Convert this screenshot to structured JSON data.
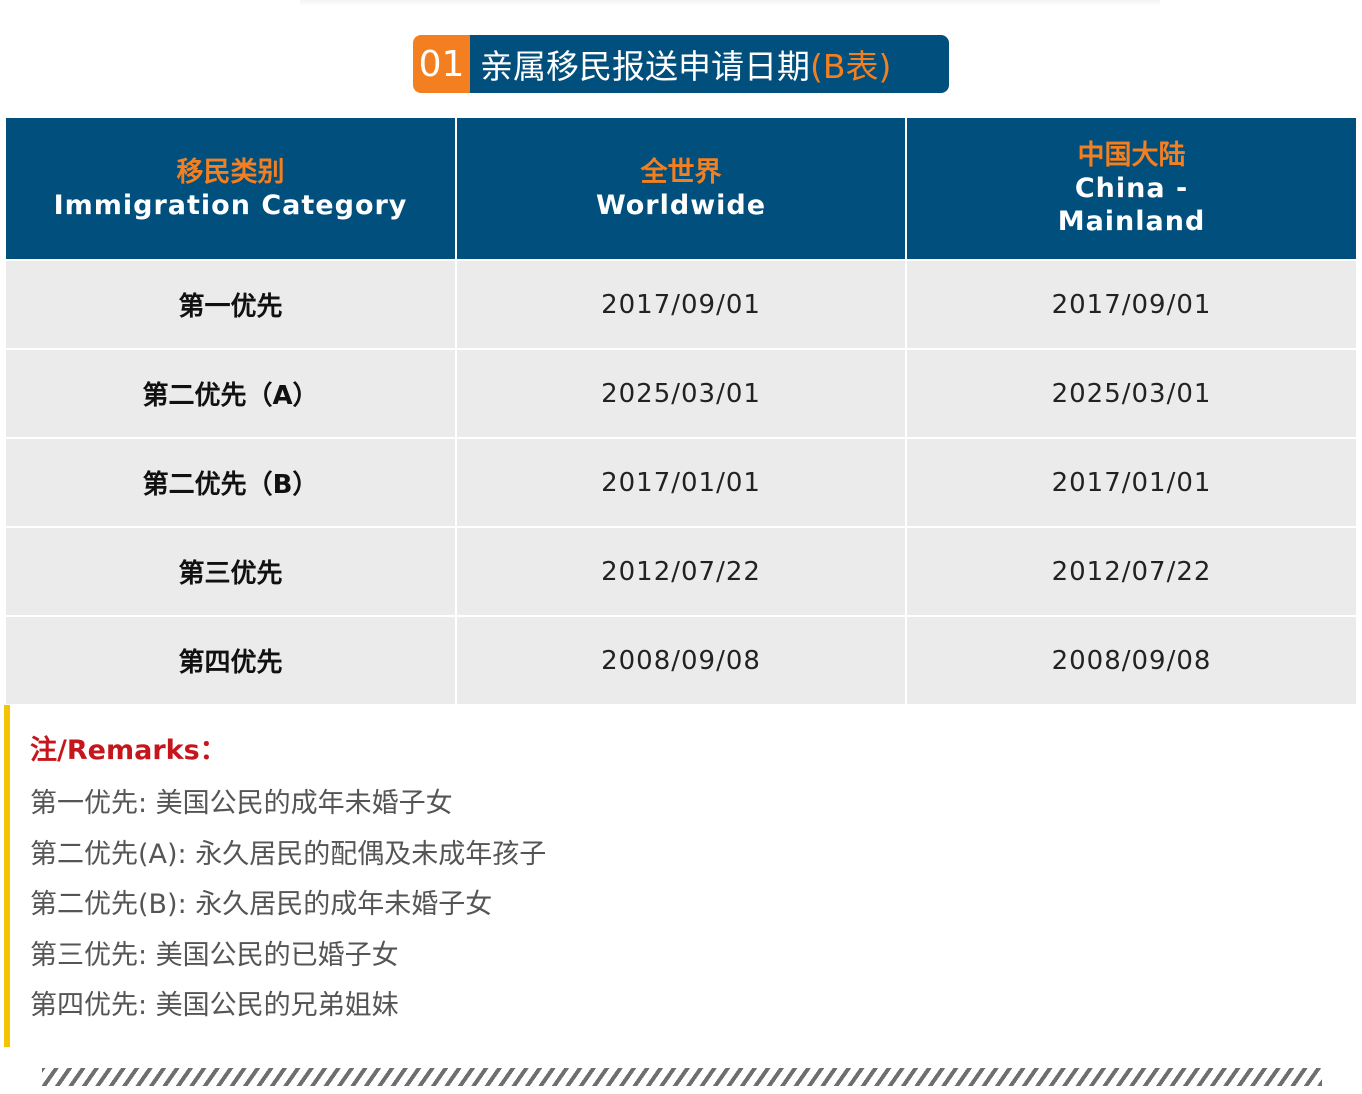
{
  "section": {
    "number": "01",
    "title": "亲属移民报送申请日期",
    "title_suffix": "(B表)"
  },
  "table": {
    "headers": [
      {
        "cn": "移民类别",
        "en": "Immigration Category"
      },
      {
        "cn": "全世界",
        "en": "Worldwide"
      },
      {
        "cn": "中国大陆",
        "en": "China - Mainland"
      }
    ],
    "rows": [
      {
        "category": "第一优先",
        "worldwide": "2017/09/01",
        "china": "2017/09/01"
      },
      {
        "category": "第二优先（A）",
        "worldwide": "2025/03/01",
        "china": "2025/03/01"
      },
      {
        "category": "第二优先（B）",
        "worldwide": "2017/01/01",
        "china": "2017/01/01"
      },
      {
        "category": "第三优先",
        "worldwide": "2012/07/22",
        "china": "2012/07/22"
      },
      {
        "category": "第四优先",
        "worldwide": "2008/09/08",
        "china": "2008/09/08"
      }
    ]
  },
  "remarks": {
    "title": "注/Remarks：",
    "lines": [
      "第一优先: 美国公民的成年未婚子女",
      "第二优先(A): 永久居民的配偶及未成年孩子",
      "第二优先(B): 永久居民的成年未婚子女",
      "第三优先: 美国公民的已婚子女",
      "第四优先: 美国公民的兄弟姐妹"
    ]
  },
  "colors": {
    "header_blue": "#004f7c",
    "accent_orange": "#f47f20",
    "row_gray": "#ebebeb",
    "remarks_red": "#c4161c",
    "remarks_bar_yellow": "#f5c400"
  }
}
